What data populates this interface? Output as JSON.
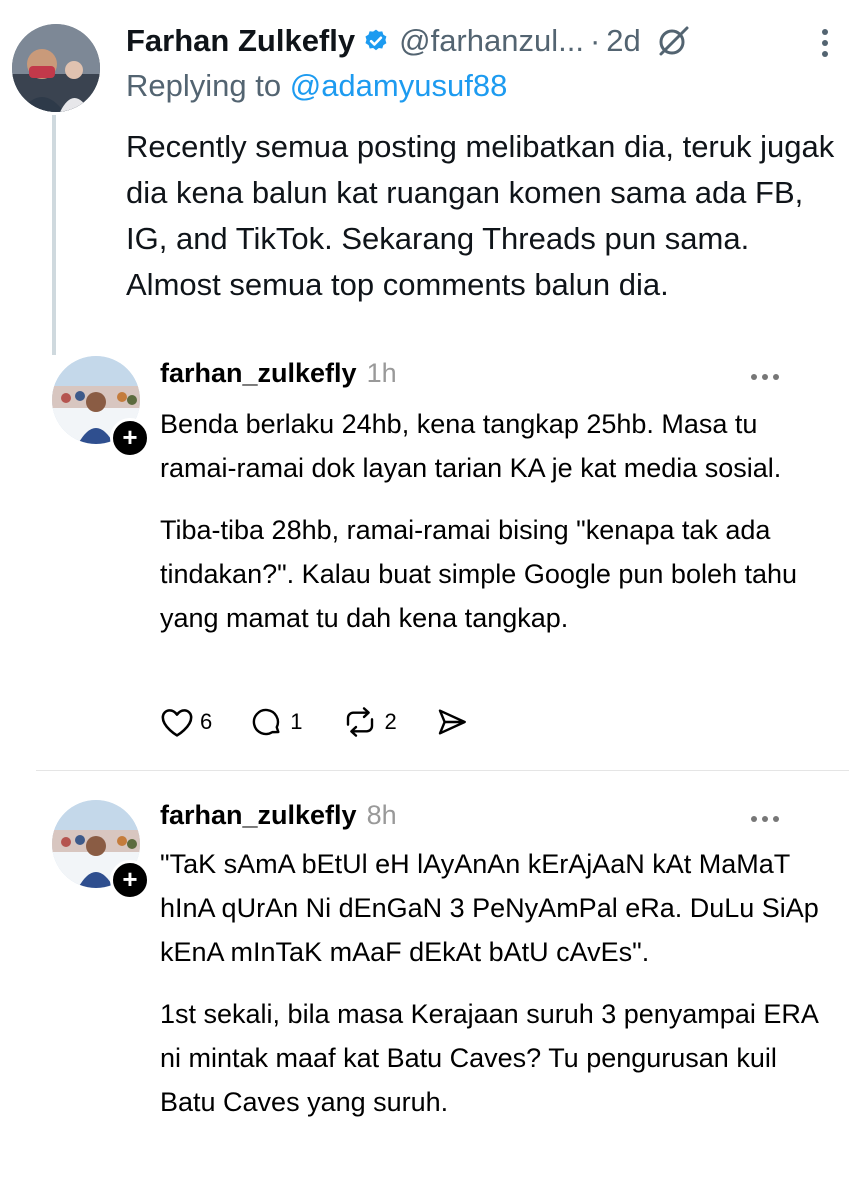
{
  "tweet": {
    "display_name": "Farhan Zulkefly",
    "handle": "@farhanzul...",
    "separator": "·",
    "time": "2d",
    "replying_prefix": "Replying to ",
    "replying_to": "@adamyusuf88",
    "body": "Recently semua posting melibatkan dia, teruk jugak dia kena balun kat ruangan komen sama ada FB, IG, and TikTok. Sekarang Threads pun sama. Almost semua top comments balun dia.",
    "icons": [
      "verified-badge-icon",
      "grok-icon",
      "more-vertical-icon"
    ],
    "colors": {
      "accent": "#1d9bf0",
      "secondary_text": "#536471"
    }
  },
  "threads": [
    {
      "username": "farhan_zulkefly",
      "time": "1h",
      "paragraphs": [
        "Benda berlaku 24hb, kena tangkap 25hb. Masa tu ramai-ramai dok layan tarian KA je kat media sosial.",
        "Tiba-tiba 28hb, ramai-ramai bising \"kenapa tak ada tindakan?\". Kalau buat simple Google pun boleh tahu yang mamat tu dah kena tangkap."
      ],
      "actions": {
        "likes": "6",
        "replies": "1",
        "reposts": "2"
      }
    },
    {
      "username": "farhan_zulkefly",
      "time": "8h",
      "paragraphs": [
        "\"TaK sAmA bEtUl eH lAyAnAn kErAjAaN kAt MaMaT hInA qUrAn Ni dEnGaN 3 PeNyAmPal eRa. DuLu SiAp kEnA mInTaK mAaF dEkAt bAtU cAvEs\".",
        "1st sekali, bila masa Kerajaan suruh 3 penyampai ERA ni mintak maaf kat Batu Caves? Tu pengurusan kuil Batu Caves yang suruh."
      ]
    }
  ]
}
